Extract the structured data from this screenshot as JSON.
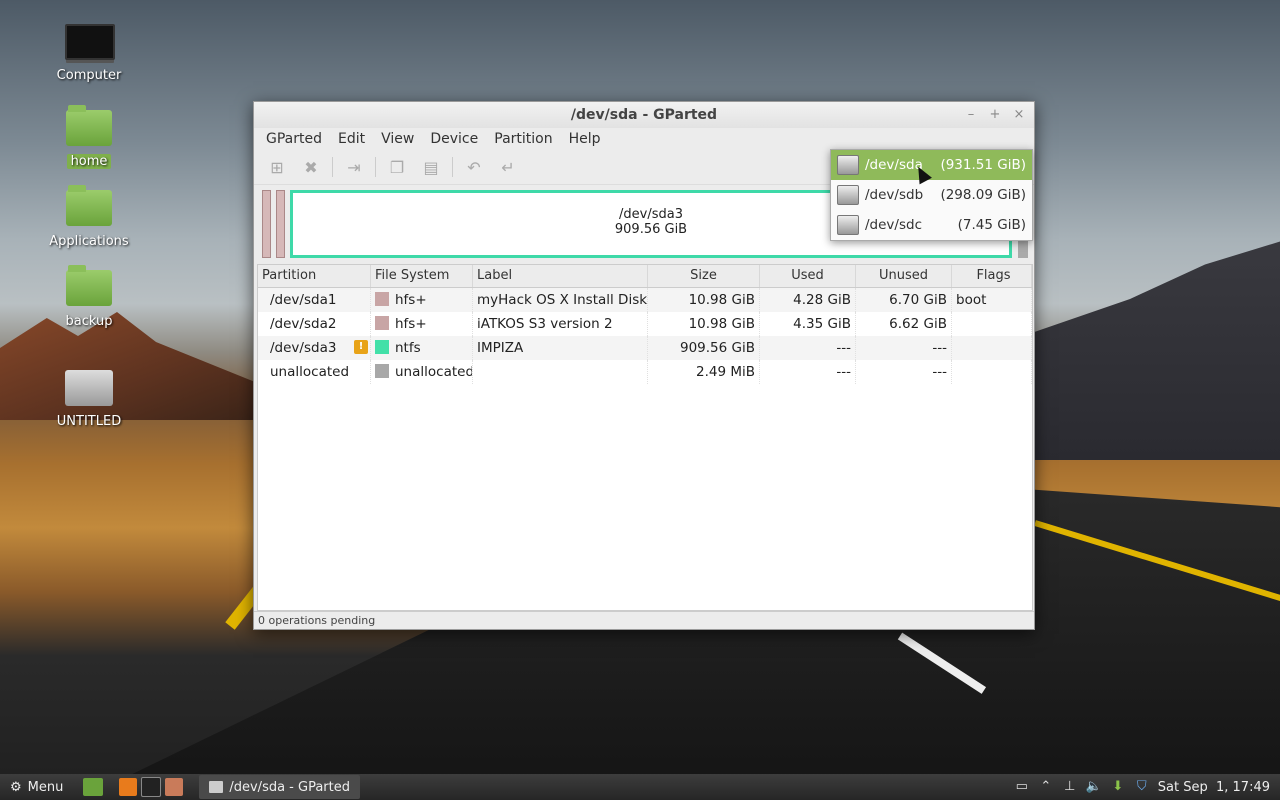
{
  "desktop": {
    "icons": [
      {
        "label": "Computer"
      },
      {
        "label": "home"
      },
      {
        "label": "Applications"
      },
      {
        "label": "backup"
      },
      {
        "label": "UNTITLED"
      }
    ]
  },
  "window": {
    "title": "/dev/sda - GParted",
    "controls": {
      "minimize": "–",
      "maximize": "+",
      "close": "×"
    },
    "menu": [
      "GParted",
      "Edit",
      "View",
      "Device",
      "Partition",
      "Help"
    ],
    "toolbar_icons": [
      "new-partition-icon",
      "delete-icon",
      "resize-move-icon",
      "copy-icon",
      "paste-icon",
      "undo-icon",
      "apply-icon"
    ],
    "disk_graphic": {
      "name": "/dev/sda3",
      "size": "909.56 GiB"
    },
    "columns": [
      "Partition",
      "File System",
      "Label",
      "Size",
      "Used",
      "Unused",
      "Flags"
    ],
    "rows": [
      {
        "partition": "/dev/sda1",
        "fs": "hfs+",
        "fs_color": "#c8a5a5",
        "label": "myHack OS X Install Disk",
        "size": "10.98 GiB",
        "used": "4.28 GiB",
        "unused": "6.70 GiB",
        "flags": "boot",
        "warning": false
      },
      {
        "partition": "/dev/sda2",
        "fs": "hfs+",
        "fs_color": "#c8a5a5",
        "label": "iATKOS S3 version 2",
        "size": "10.98 GiB",
        "used": "4.35 GiB",
        "unused": "6.62 GiB",
        "flags": "",
        "warning": false
      },
      {
        "partition": "/dev/sda3",
        "fs": "ntfs",
        "fs_color": "#42e0a8",
        "label": "IMPIZA",
        "size": "909.56 GiB",
        "used": "---",
        "unused": "---",
        "flags": "",
        "warning": true
      },
      {
        "partition": "unallocated",
        "fs": "unallocated",
        "fs_color": "#a8a8a8",
        "label": "",
        "size": "2.49 MiB",
        "used": "---",
        "unused": "---",
        "flags": "",
        "warning": false
      }
    ],
    "status": "0 operations pending"
  },
  "device_dropdown": {
    "items": [
      {
        "device": "/dev/sda",
        "size": "(931.51 GiB)",
        "selected": true
      },
      {
        "device": "/dev/sdb",
        "size": "(298.09 GiB)",
        "selected": false
      },
      {
        "device": "/dev/sdc",
        "size": "(7.45 GiB)",
        "selected": false
      }
    ]
  },
  "taskbar": {
    "menu_label": "Menu",
    "task_title": "/dev/sda - GParted",
    "clock": "Sat Sep  1, 17:49"
  }
}
